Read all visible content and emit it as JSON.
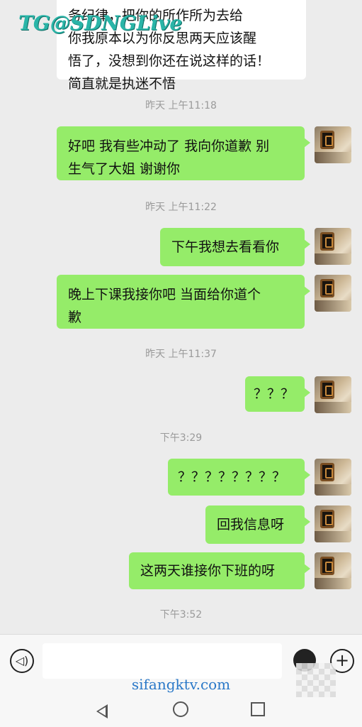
{
  "watermark_top": "TG@SDNGLive",
  "messages": {
    "m1": {
      "text": "务纪律，把你的所作所为去给\n你我原本以为你反思两天应该醒\n悟了，没想到你还在说这样的话！\n简直就是执迷不悟"
    },
    "t1": "昨天 上午11:18",
    "m2": {
      "text": "好吧 我有些冲动了 我向你道歉 别\n生气了大姐 谢谢你"
    },
    "t2": "昨天 上午11:22",
    "m3": {
      "text": "下午我想去看看你"
    },
    "m4": {
      "text": "晚上下课我接你吧 当面给你道个\n歉"
    },
    "t3": "昨天 上午11:37",
    "m5": {
      "text": "？？？"
    },
    "t4": "下午3:29",
    "m6": {
      "text": "？？？？？？？？"
    },
    "m7": {
      "text": "回我信息呀"
    },
    "m8": {
      "text": "这两天谁接你下班的呀"
    },
    "t5": "下午3:52"
  },
  "input": {
    "placeholder": ""
  },
  "site_watermark": "sifangktv.com"
}
